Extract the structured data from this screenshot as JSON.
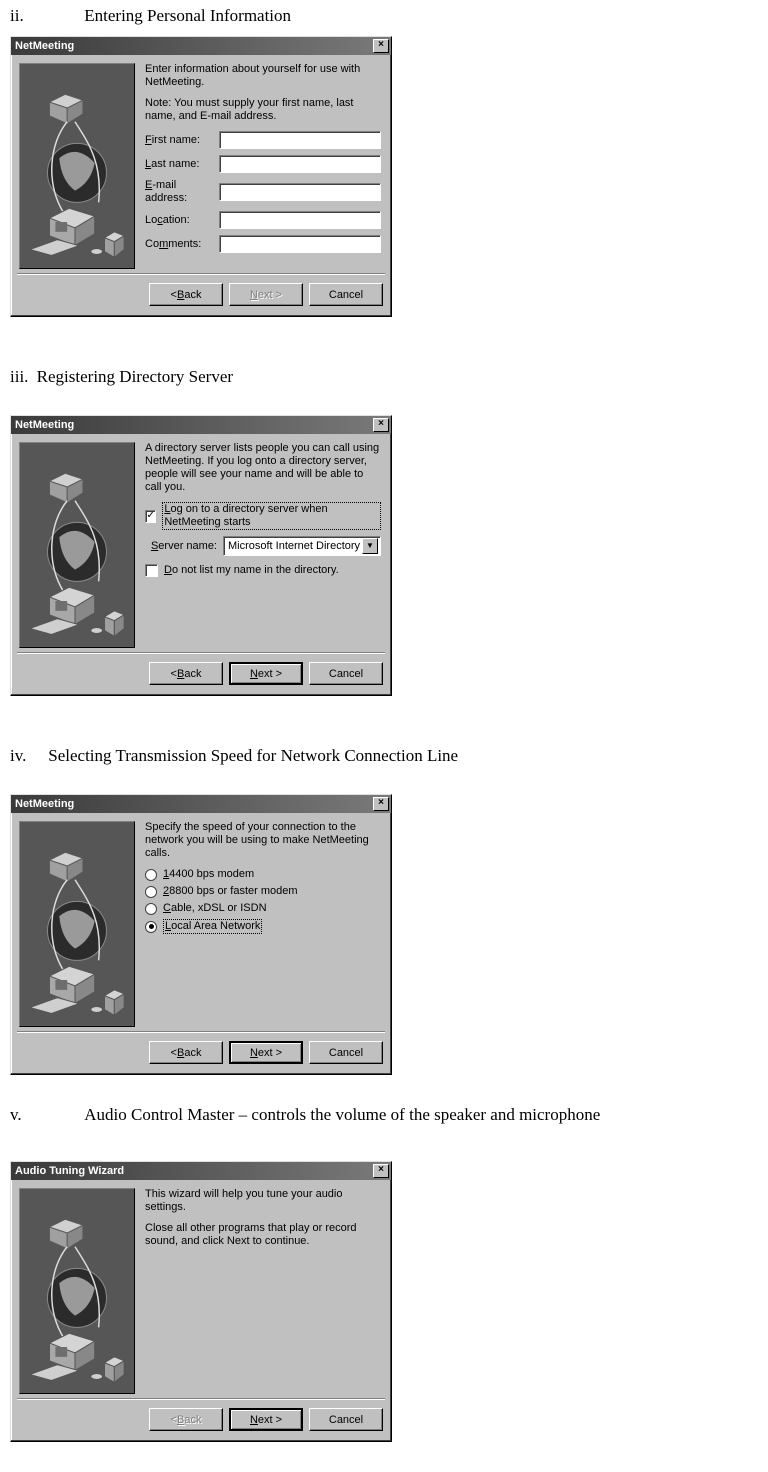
{
  "sections": {
    "s2": {
      "num": "ii.",
      "text": "Entering Personal Information"
    },
    "s3": {
      "num": "iii.",
      "text": "Registering Directory Server"
    },
    "s4": {
      "num": "iv.",
      "text": "Selecting Transmission Speed for Network Connection Line"
    },
    "s5": {
      "num": "v.",
      "text": "Audio Control Master – controls the volume of the speaker and microphone"
    }
  },
  "common": {
    "title_netmeeting": "NetMeeting",
    "title_audio": "Audio Tuning Wizard",
    "close_x": "×",
    "btn_back": "< Back",
    "btn_next": "Next >",
    "btn_cancel": "Cancel",
    "arrow_down": "▼"
  },
  "dlg2": {
    "intro": "Enter information about yourself for use with NetMeeting.",
    "note": "Note: You must supply your first name, last name, and E-mail address.",
    "labels": {
      "first": "First name:",
      "last": "Last name:",
      "email": "E-mail address:",
      "location": "Location:",
      "comments": "Comments:"
    }
  },
  "dlg3": {
    "intro": "A directory server lists people you can call using NetMeeting. If you log onto a directory server, people will see your name and will be able to call you.",
    "chk_logon": "Log on to a directory server when NetMeeting starts",
    "server_label": "Server name:",
    "server_value": "Microsoft Internet Directory",
    "chk_nolist": "Do not list my name in the directory."
  },
  "dlg4": {
    "intro": "Specify the speed of your connection to the network you will be using to make NetMeeting calls.",
    "opts": {
      "o1": "14400 bps modem",
      "o2": "28800 bps or faster modem",
      "o3": "Cable, xDSL or ISDN",
      "o4": "Local Area Network"
    }
  },
  "dlg5": {
    "line1": "This wizard will help you tune your audio settings.",
    "line2": "Close all other programs that play or record sound, and click Next to continue."
  }
}
